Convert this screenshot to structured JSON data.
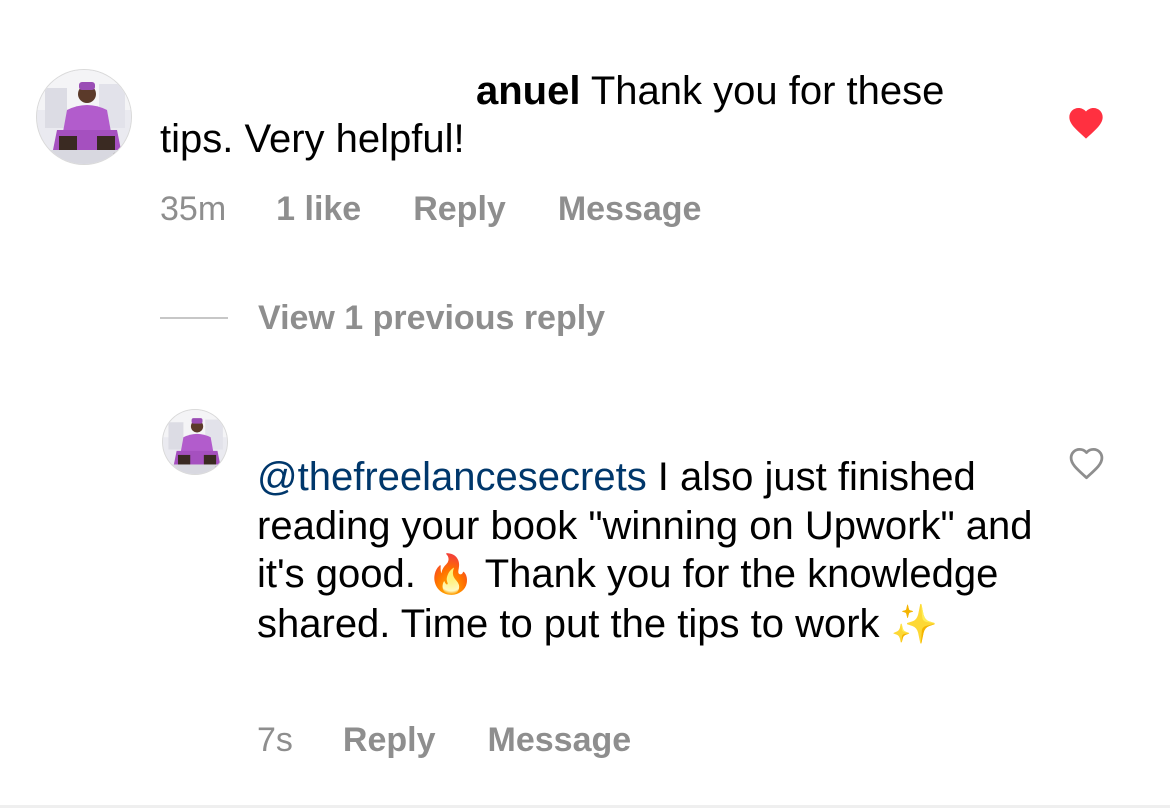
{
  "comment_1": {
    "username_visible": "anuel",
    "text": " Thank you for these tips. Very helpful!",
    "time": "35m",
    "likes": "1 like",
    "reply_label": "Reply",
    "message_label": "Message",
    "liked": true,
    "heart_color": "#ff3040"
  },
  "view_replies": {
    "label": "View 1 previous reply"
  },
  "comment_2": {
    "mention": "@thefreelancesecrets",
    "text_part1": " I also just finished reading your book \"winning on Upwork\" and it's good. ",
    "emoji_fire": "🔥",
    "text_part2": " Thank you for the knowledge shared. Time to put the tips to work ",
    "emoji_sparkles": "✨",
    "time": "7s",
    "reply_label": "Reply",
    "message_label": "Message",
    "liked": false
  },
  "colors": {
    "meta_gray": "#8e8e8e",
    "mention_blue": "#00376b",
    "heart_red": "#ff3040"
  },
  "icons": {
    "heart_filled": "heart-filled-icon",
    "heart_outline": "heart-outline-icon"
  }
}
